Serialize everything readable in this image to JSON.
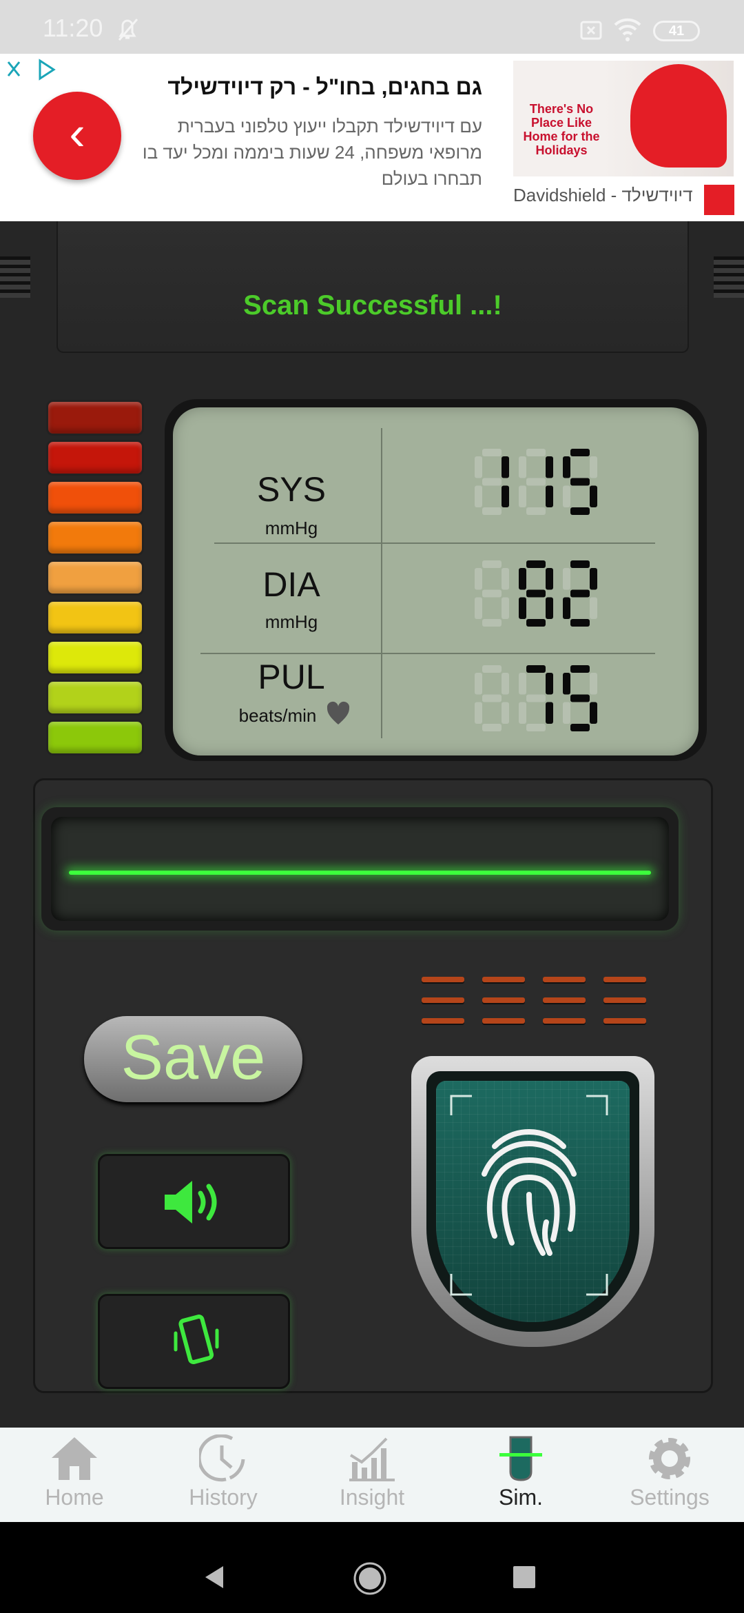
{
  "status_bar": {
    "time": "11:20",
    "battery": "41",
    "icons": [
      "bell-off-icon",
      "sim-x-icon",
      "wifi-icon",
      "battery-icon"
    ]
  },
  "ad": {
    "title": "גם בחגים, בחו\"ל - רק דיוידשילד",
    "body": "עם דיוידשילד תקבלו ייעוץ טלפוני בעברית מרופאי משפחה, 24 שעות ביממה ומכל יעד בו תבחרו בעולם",
    "image_text": "There's No Place Like Home for the Holidays",
    "brand": "Davidshield - דיוידשילד",
    "back_icon": "chevron-left-icon",
    "accent": "#e41e26"
  },
  "scan": {
    "message": "Scan Successful ...!",
    "color": "#4ccb2a"
  },
  "led_colors": [
    "#9a1a0c",
    "#c5160a",
    "#f0500a",
    "#f27a0c",
    "#f0a040",
    "#f2c414",
    "#dde80a",
    "#b2d21a",
    "#8cc80a"
  ],
  "readings": [
    {
      "label": "SYS",
      "unit": "mmHg",
      "value": "115"
    },
    {
      "label": "DIA",
      "unit": "mmHg",
      "value": "82"
    },
    {
      "label": "PUL",
      "unit": "beats/min",
      "value": "75"
    }
  ],
  "buttons": {
    "save": "Save",
    "sound_icon": "speaker-icon",
    "vibrate_icon": "vibrate-icon",
    "scanner_icon": "fingerprint-icon"
  },
  "nav": {
    "items": [
      {
        "label": "Home",
        "icon": "home-icon"
      },
      {
        "label": "History",
        "icon": "history-icon"
      },
      {
        "label": "Insight",
        "icon": "chart-icon"
      },
      {
        "label": "Sim.",
        "icon": "fingerprint-icon",
        "active": true
      },
      {
        "label": "Settings",
        "icon": "gear-icon"
      }
    ]
  }
}
